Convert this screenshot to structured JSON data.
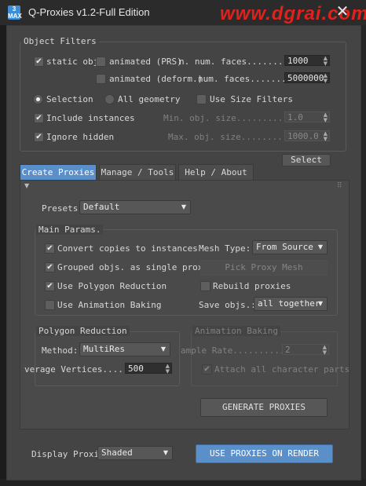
{
  "window": {
    "title": "Q-Proxies v1.2-Full Edition",
    "app_icon_text": "3\nMAX",
    "close_glyph": "✕"
  },
  "watermark": "www.dgrai.com",
  "object_filters": {
    "title": "Object Filters",
    "static_obj": {
      "label": "static obj",
      "checked": true
    },
    "animated_prs": {
      "label": "animated (PRS)",
      "checked": false
    },
    "animated_deform": {
      "label": "animated (deform.)",
      "checked": false
    },
    "n_num_faces_label_1": "n. num. faces.........",
    "n_num_faces_value_1": "1000",
    "n_num_faces_label_2": "num. faces........",
    "n_num_faces_value_2": "5000000",
    "selection": {
      "label": "Selection",
      "selected": true
    },
    "all_geometry": {
      "label": "All geometry",
      "selected": false
    },
    "use_size_filters": {
      "label": "Use Size Filters",
      "checked": false
    },
    "include_instances": {
      "label": "Include instances",
      "checked": true
    },
    "ignore_hidden": {
      "label": "Ignore hidden",
      "checked": true
    },
    "min_obj_size_label": "Min. obj. size.........",
    "min_obj_size_value": "1.0",
    "max_obj_size_label": "Max. obj. size........",
    "max_obj_size_value": "1000.0",
    "select_button": "Select"
  },
  "tabs": [
    {
      "label": "Create Proxies",
      "active": true
    },
    {
      "label": "Manage / Tools",
      "active": false
    },
    {
      "label": "Help / About",
      "active": false
    }
  ],
  "presets": {
    "label": "Presets:",
    "value": "Default"
  },
  "main_params": {
    "title": "Main Params.",
    "convert_copies": {
      "label": "Convert copies to instances",
      "checked": true
    },
    "grouped_objs": {
      "label": "Grouped objs. as single proxy",
      "checked": true
    },
    "use_polygon_reduction": {
      "label": "Use Polygon Reduction",
      "checked": true
    },
    "use_animation_baking": {
      "label": "Use Animation Baking",
      "checked": false
    },
    "mesh_type_label": "Mesh Type:",
    "mesh_type_value": "From Source",
    "pick_proxy_mesh": "Pick Proxy Mesh",
    "rebuild_proxies": {
      "label": "Rebuild proxies",
      "checked": false
    },
    "save_objs_label": "Save objs.:",
    "save_objs_value": "all together"
  },
  "polygon_reduction": {
    "title": "Polygon Reduction",
    "method_label": "Method:",
    "method_value": "MultiRes",
    "avg_vertices_label": "verage Vertices....",
    "avg_vertices_value": "500"
  },
  "animation_baking": {
    "title": "Animation Baking",
    "sample_rate_label": "ample Rate..........",
    "sample_rate_value": "2",
    "attach_all": {
      "label": "Attach all character parts",
      "checked": true
    }
  },
  "generate_button": "GENERATE PROXIES",
  "display_proxies": {
    "label": "Display Proxie",
    "value": "Shaded"
  },
  "use_proxies_button": "USE PROXIES ON RENDER",
  "panel_icons": {
    "collapse": "▼",
    "dots": "⠿"
  },
  "colors": {
    "accent": "#5b8fc9",
    "panel": "#444444",
    "title_bar": "#2b2b2b"
  }
}
